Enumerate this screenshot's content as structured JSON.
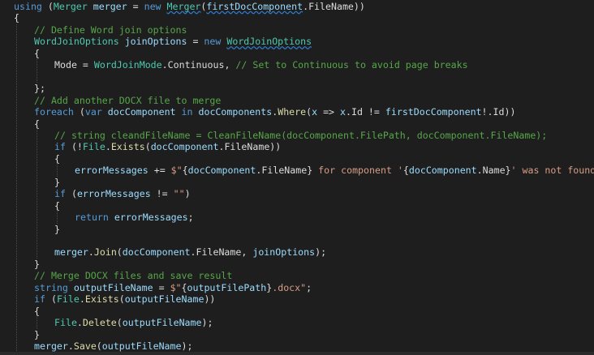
{
  "colors": {
    "background": "#1e1e1e",
    "keyword": "#569cd6",
    "type": "#4ec9b0",
    "variable": "#9cdcfe",
    "method": "#dcdcaa",
    "comment": "#57a64a",
    "string": "#d69d85",
    "plain": "#dcdcdc"
  },
  "code_lines": [
    {
      "indent": 0,
      "tokens": [
        [
          "kw",
          "using"
        ],
        [
          "pl",
          " ("
        ],
        [
          "ty",
          "Merger"
        ],
        [
          "pl",
          " "
        ],
        [
          "vr",
          "merger"
        ],
        [
          "pl",
          " = "
        ],
        [
          "kw",
          "new"
        ],
        [
          "pl",
          " "
        ],
        [
          "ty",
          "Merger"
        ],
        [
          "pl",
          "("
        ],
        [
          "vr",
          "firstDocComponent"
        ],
        [
          "pl",
          "."
        ],
        [
          "pr",
          "FileName"
        ],
        [
          "pl",
          "))"
        ]
      ]
    },
    {
      "indent": 0,
      "tokens": [
        [
          "pl",
          "{"
        ]
      ]
    },
    {
      "indent": 1,
      "tokens": [
        [
          "cm",
          "// Define Word join options"
        ]
      ]
    },
    {
      "indent": 1,
      "tokens": [
        [
          "ty",
          "WordJoinOptions"
        ],
        [
          "pl",
          " "
        ],
        [
          "vr",
          "joinOptions"
        ],
        [
          "pl",
          " = "
        ],
        [
          "kw",
          "new"
        ],
        [
          "pl",
          " "
        ],
        [
          "ty",
          "WordJoinOptions"
        ]
      ]
    },
    {
      "indent": 1,
      "tokens": [
        [
          "pl",
          "{"
        ]
      ]
    },
    {
      "indent": 2,
      "tokens": [
        [
          "pr",
          "Mode"
        ],
        [
          "pl",
          " = "
        ],
        [
          "ty",
          "WordJoinMode"
        ],
        [
          "pl",
          "."
        ],
        [
          "pr",
          "Continuous"
        ],
        [
          "pl",
          ", "
        ],
        [
          "cm",
          "// Set to Continuous to avoid page breaks"
        ]
      ]
    },
    {
      "indent": 0,
      "tokens": []
    },
    {
      "indent": 1,
      "tokens": [
        [
          "pl",
          "};"
        ]
      ]
    },
    {
      "indent": 1,
      "tokens": [
        [
          "cm",
          "// Add another DOCX file to merge"
        ]
      ]
    },
    {
      "indent": 1,
      "tokens": [
        [
          "kw",
          "foreach"
        ],
        [
          "pl",
          " ("
        ],
        [
          "kw",
          "var"
        ],
        [
          "pl",
          " "
        ],
        [
          "vr",
          "docComponent"
        ],
        [
          "pl",
          " "
        ],
        [
          "kw",
          "in"
        ],
        [
          "pl",
          " "
        ],
        [
          "vr",
          "docComponents"
        ],
        [
          "pl",
          "."
        ],
        [
          "fn",
          "Where"
        ],
        [
          "pl",
          "("
        ],
        [
          "vr",
          "x"
        ],
        [
          "pl",
          " => "
        ],
        [
          "vr",
          "x"
        ],
        [
          "pl",
          "."
        ],
        [
          "pr",
          "Id"
        ],
        [
          "pl",
          " != "
        ],
        [
          "vr",
          "firstDocComponent"
        ],
        [
          "pl",
          "!."
        ],
        [
          "pr",
          "Id"
        ],
        [
          "pl",
          "))"
        ]
      ]
    },
    {
      "indent": 1,
      "tokens": [
        [
          "pl",
          "{"
        ]
      ]
    },
    {
      "indent": 2,
      "tokens": [
        [
          "cm",
          "// string cleandFileName = CleanFileName(docComponent.FilePath, docComponent.FileName);"
        ]
      ]
    },
    {
      "indent": 2,
      "tokens": [
        [
          "kw",
          "if"
        ],
        [
          "pl",
          " (!"
        ],
        [
          "ty",
          "File"
        ],
        [
          "pl",
          "."
        ],
        [
          "fn",
          "Exists"
        ],
        [
          "pl",
          "("
        ],
        [
          "vr",
          "docComponent"
        ],
        [
          "pl",
          "."
        ],
        [
          "pr",
          "FileName"
        ],
        [
          "pl",
          "))"
        ]
      ]
    },
    {
      "indent": 2,
      "tokens": [
        [
          "pl",
          "{"
        ]
      ]
    },
    {
      "indent": 3,
      "tokens": [
        [
          "vr",
          "errorMessages"
        ],
        [
          "pl",
          " += "
        ],
        [
          "st",
          "$\""
        ],
        [
          "pl",
          "{"
        ],
        [
          "vr",
          "docComponent"
        ],
        [
          "pl",
          "."
        ],
        [
          "pr",
          "FileName"
        ],
        [
          "pl",
          "}"
        ],
        [
          "st",
          " for component '"
        ],
        [
          "pl",
          "{"
        ],
        [
          "vr",
          "docComponent"
        ],
        [
          "pl",
          "."
        ],
        [
          "pr",
          "Name"
        ],
        [
          "pl",
          "}"
        ],
        [
          "st",
          "' was not found. \""
        ],
        [
          "pl",
          ";"
        ]
      ]
    },
    {
      "indent": 2,
      "tokens": [
        [
          "pl",
          "}"
        ]
      ]
    },
    {
      "indent": 2,
      "tokens": [
        [
          "kw",
          "if"
        ],
        [
          "pl",
          " ("
        ],
        [
          "vr",
          "errorMessages"
        ],
        [
          "pl",
          " != "
        ],
        [
          "st",
          "\"\""
        ],
        [
          "pl",
          ")"
        ]
      ]
    },
    {
      "indent": 2,
      "tokens": [
        [
          "pl",
          "{"
        ]
      ]
    },
    {
      "indent": 3,
      "tokens": [
        [
          "kw",
          "return"
        ],
        [
          "pl",
          " "
        ],
        [
          "vr",
          "errorMessages"
        ],
        [
          "pl",
          ";"
        ]
      ]
    },
    {
      "indent": 2,
      "tokens": [
        [
          "pl",
          "}"
        ]
      ]
    },
    {
      "indent": 0,
      "tokens": []
    },
    {
      "indent": 2,
      "tokens": [
        [
          "vr",
          "merger"
        ],
        [
          "pl",
          "."
        ],
        [
          "fn",
          "Join"
        ],
        [
          "pl",
          "("
        ],
        [
          "vr",
          "docComponent"
        ],
        [
          "pl",
          "."
        ],
        [
          "pr",
          "FileName"
        ],
        [
          "pl",
          ", "
        ],
        [
          "vr",
          "joinOptions"
        ],
        [
          "pl",
          ");"
        ]
      ]
    },
    {
      "indent": 1,
      "tokens": [
        [
          "pl",
          "}"
        ]
      ]
    },
    {
      "indent": 1,
      "tokens": [
        [
          "cm",
          "// Merge DOCX files and save result"
        ]
      ]
    },
    {
      "indent": 1,
      "tokens": [
        [
          "kw",
          "string"
        ],
        [
          "pl",
          " "
        ],
        [
          "vr",
          "outputFileName"
        ],
        [
          "pl",
          " = "
        ],
        [
          "st",
          "$\""
        ],
        [
          "pl",
          "{"
        ],
        [
          "vr",
          "outputFilePath"
        ],
        [
          "pl",
          "}"
        ],
        [
          "st",
          ".docx\""
        ],
        [
          "pl",
          ";"
        ]
      ]
    },
    {
      "indent": 1,
      "tokens": [
        [
          "kw",
          "if"
        ],
        [
          "pl",
          " ("
        ],
        [
          "ty",
          "File"
        ],
        [
          "pl",
          "."
        ],
        [
          "fn",
          "Exists"
        ],
        [
          "pl",
          "("
        ],
        [
          "vr",
          "outputFileName"
        ],
        [
          "pl",
          "))"
        ]
      ]
    },
    {
      "indent": 1,
      "tokens": [
        [
          "pl",
          "{"
        ]
      ]
    },
    {
      "indent": 2,
      "tokens": [
        [
          "ty",
          "File"
        ],
        [
          "pl",
          "."
        ],
        [
          "fn",
          "Delete"
        ],
        [
          "pl",
          "("
        ],
        [
          "vr",
          "outputFileName"
        ],
        [
          "pl",
          ");"
        ]
      ]
    },
    {
      "indent": 1,
      "tokens": [
        [
          "pl",
          "}"
        ]
      ]
    },
    {
      "indent": 1,
      "tokens": [
        [
          "vr",
          "merger"
        ],
        [
          "pl",
          "."
        ],
        [
          "fn",
          "Save"
        ],
        [
          "pl",
          "("
        ],
        [
          "vr",
          "outputFileName"
        ],
        [
          "pl",
          ");"
        ]
      ]
    }
  ]
}
